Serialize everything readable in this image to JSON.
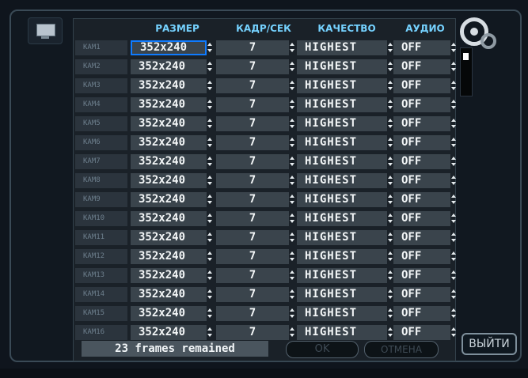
{
  "columns": {
    "size": "РАЗМЕР",
    "fps": "КАДР/СЕК",
    "quality": "КАЧЕСТВО",
    "audio": "АУДИО"
  },
  "rows": [
    {
      "cam": "КАМ1",
      "size": "352x240",
      "fps": "7",
      "quality": "HIGHEST",
      "audio": "OFF"
    },
    {
      "cam": "КАМ2",
      "size": "352x240",
      "fps": "7",
      "quality": "HIGHEST",
      "audio": "OFF"
    },
    {
      "cam": "КАМ3",
      "size": "352x240",
      "fps": "7",
      "quality": "HIGHEST",
      "audio": "OFF"
    },
    {
      "cam": "КАМ4",
      "size": "352x240",
      "fps": "7",
      "quality": "HIGHEST",
      "audio": "OFF"
    },
    {
      "cam": "КАМ5",
      "size": "352x240",
      "fps": "7",
      "quality": "HIGHEST",
      "audio": "OFF"
    },
    {
      "cam": "КАМ6",
      "size": "352x240",
      "fps": "7",
      "quality": "HIGHEST",
      "audio": "OFF"
    },
    {
      "cam": "КАМ7",
      "size": "352x240",
      "fps": "7",
      "quality": "HIGHEST",
      "audio": "OFF"
    },
    {
      "cam": "КАМ8",
      "size": "352x240",
      "fps": "7",
      "quality": "HIGHEST",
      "audio": "OFF"
    },
    {
      "cam": "КАМ9",
      "size": "352x240",
      "fps": "7",
      "quality": "HIGHEST",
      "audio": "OFF"
    },
    {
      "cam": "КАМ10",
      "size": "352x240",
      "fps": "7",
      "quality": "HIGHEST",
      "audio": "OFF"
    },
    {
      "cam": "КАМ11",
      "size": "352x240",
      "fps": "7",
      "quality": "HIGHEST",
      "audio": "OFF"
    },
    {
      "cam": "КАМ12",
      "size": "352x240",
      "fps": "7",
      "quality": "HIGHEST",
      "audio": "OFF"
    },
    {
      "cam": "КАМ13",
      "size": "352x240",
      "fps": "7",
      "quality": "HIGHEST",
      "audio": "OFF"
    },
    {
      "cam": "КАМ14",
      "size": "352x240",
      "fps": "7",
      "quality": "HIGHEST",
      "audio": "OFF"
    },
    {
      "cam": "КАМ15",
      "size": "352x240",
      "fps": "7",
      "quality": "HIGHEST",
      "audio": "OFF"
    },
    {
      "cam": "КАМ16",
      "size": "352x240",
      "fps": "7",
      "quality": "HIGHEST",
      "audio": "OFF"
    }
  ],
  "footer": {
    "remaining": "23 frames remained",
    "ok": "OK",
    "cancel": "ОТМЕНА"
  },
  "exit": "ВЫЙТИ",
  "colors": {
    "header": "#75d2ff",
    "selection": "#0f7bff"
  },
  "icons": {
    "left": "monitor-icon",
    "right": "gear-icon"
  }
}
